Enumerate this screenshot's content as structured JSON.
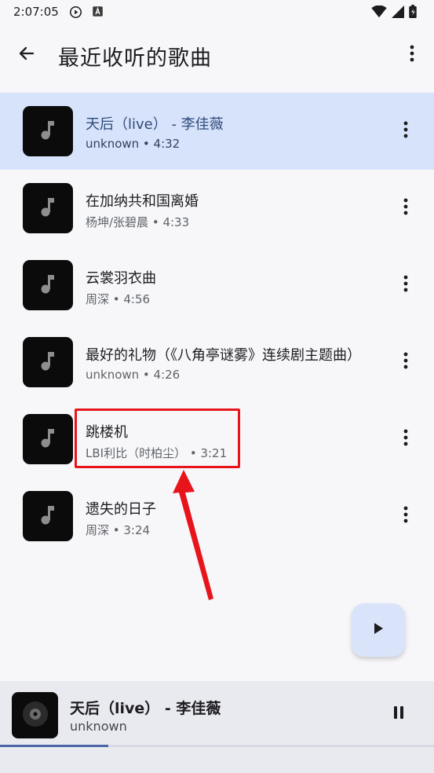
{
  "status_bar": {
    "time": "2:07:05",
    "icons": [
      "play-circle-icon",
      "a-box-icon",
      "wifi-icon",
      "signal-icon",
      "battery-icon"
    ]
  },
  "app_bar": {
    "title": "最近收听的歌曲",
    "back_icon": "arrow-back-icon",
    "more_icon": "more-vert-icon"
  },
  "songs": [
    {
      "title": "天后（live） - 李佳薇",
      "subtitle": "unknown • 4:32",
      "active": true
    },
    {
      "title": "在加纳共和国离婚",
      "subtitle": "杨坤/张碧晨 • 4:33",
      "active": false
    },
    {
      "title": "云裳羽衣曲",
      "subtitle": "周深 • 4:56",
      "active": false
    },
    {
      "title": "最好的礼物（《八角亭谜雾》连续剧主题曲）",
      "subtitle": "unknown • 4:26",
      "active": false
    },
    {
      "title": "跳楼机",
      "subtitle": "LBI利比（时柏尘） • 3:21",
      "active": false
    },
    {
      "title": "遗失的日子",
      "subtitle": "周深 • 3:24",
      "active": false
    }
  ],
  "fab": {
    "icon": "play-icon"
  },
  "mini_player": {
    "title": "天后（live） - 李佳薇",
    "artist": "unknown",
    "progress": 0.25,
    "pause_icon": "pause-icon"
  },
  "colors": {
    "active_row": "#d7e3fb",
    "annotation": "#e8141c",
    "progress": "#4a65a8"
  }
}
